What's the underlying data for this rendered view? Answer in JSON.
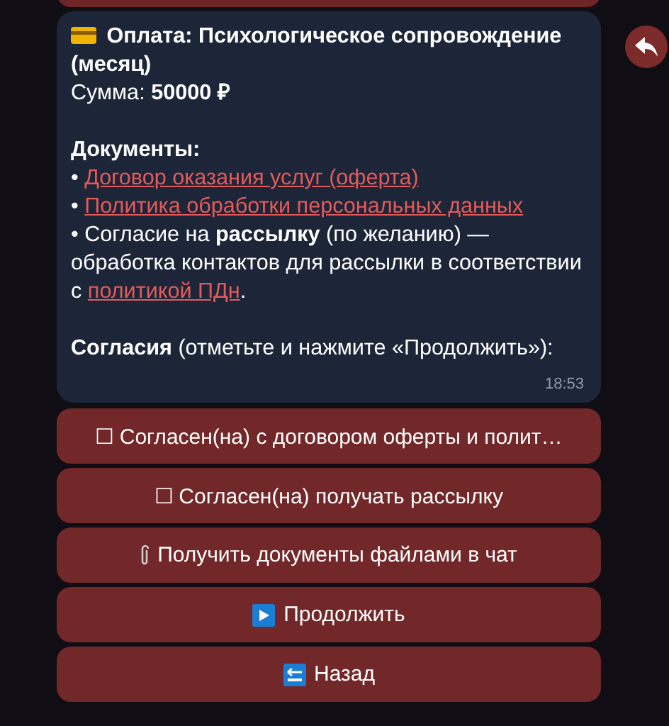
{
  "message": {
    "paragraphs": [
      {
        "kind": "payment",
        "parts": [
          {
            "kind": "text",
            "text": "**Оплата: Психологическое сопровождение (месяц)**"
          }
        ]
      },
      {
        "kind": "line",
        "parts": [
          {
            "kind": "text",
            "text": "Сумма: **50000 ₽**"
          }
        ]
      },
      {
        "kind": "section",
        "parts": [
          {
            "kind": "text",
            "text": "**Документы:**"
          }
        ]
      },
      {
        "kind": "line",
        "parts": [
          {
            "kind": "text",
            "text": "• "
          },
          {
            "kind": "link",
            "text": "Договор оказания услуг (оферта)"
          }
        ]
      },
      {
        "kind": "line",
        "parts": [
          {
            "kind": "text",
            "text": "• "
          },
          {
            "kind": "link",
            "text": "Политика обработки персональных данных"
          }
        ]
      },
      {
        "kind": "line",
        "parts": [
          {
            "kind": "text",
            "text": "• Согласие на **рассылку** (по желанию) — обработка контактов для рассылки в соответствии с "
          },
          {
            "kind": "link",
            "text": "политикой ПДн"
          },
          {
            "kind": "text",
            "text": "."
          }
        ]
      },
      {
        "kind": "section",
        "parts": [
          {
            "kind": "text",
            "text": "**Согласия** (отметьте и нажмите «Продолжить»):"
          }
        ]
      }
    ],
    "time": "18:53"
  },
  "buttons": [
    {
      "kind": "text",
      "label": "☐ Согласен(на) с договором оферты и полит…"
    },
    {
      "kind": "text",
      "label": "☐ Согласен(на) получать рассылку"
    },
    {
      "kind": "paperclip",
      "label": "Получить документы файлами в чат"
    },
    {
      "kind": "play",
      "label": "Продолжить"
    },
    {
      "kind": "back",
      "label": "Назад"
    }
  ]
}
